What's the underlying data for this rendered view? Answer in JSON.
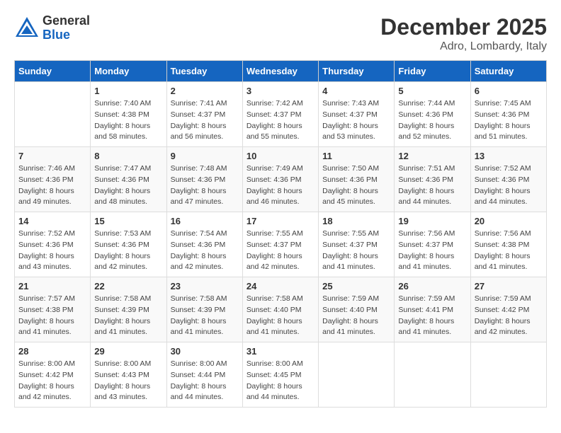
{
  "header": {
    "logo_general": "General",
    "logo_blue": "Blue",
    "month": "December 2025",
    "location": "Adro, Lombardy, Italy"
  },
  "weekdays": [
    "Sunday",
    "Monday",
    "Tuesday",
    "Wednesday",
    "Thursday",
    "Friday",
    "Saturday"
  ],
  "weeks": [
    [
      {
        "day": "",
        "sunrise": "",
        "sunset": "",
        "daylight": ""
      },
      {
        "day": "1",
        "sunrise": "Sunrise: 7:40 AM",
        "sunset": "Sunset: 4:38 PM",
        "daylight": "Daylight: 8 hours and 58 minutes."
      },
      {
        "day": "2",
        "sunrise": "Sunrise: 7:41 AM",
        "sunset": "Sunset: 4:37 PM",
        "daylight": "Daylight: 8 hours and 56 minutes."
      },
      {
        "day": "3",
        "sunrise": "Sunrise: 7:42 AM",
        "sunset": "Sunset: 4:37 PM",
        "daylight": "Daylight: 8 hours and 55 minutes."
      },
      {
        "day": "4",
        "sunrise": "Sunrise: 7:43 AM",
        "sunset": "Sunset: 4:37 PM",
        "daylight": "Daylight: 8 hours and 53 minutes."
      },
      {
        "day": "5",
        "sunrise": "Sunrise: 7:44 AM",
        "sunset": "Sunset: 4:36 PM",
        "daylight": "Daylight: 8 hours and 52 minutes."
      },
      {
        "day": "6",
        "sunrise": "Sunrise: 7:45 AM",
        "sunset": "Sunset: 4:36 PM",
        "daylight": "Daylight: 8 hours and 51 minutes."
      }
    ],
    [
      {
        "day": "7",
        "sunrise": "Sunrise: 7:46 AM",
        "sunset": "Sunset: 4:36 PM",
        "daylight": "Daylight: 8 hours and 49 minutes."
      },
      {
        "day": "8",
        "sunrise": "Sunrise: 7:47 AM",
        "sunset": "Sunset: 4:36 PM",
        "daylight": "Daylight: 8 hours and 48 minutes."
      },
      {
        "day": "9",
        "sunrise": "Sunrise: 7:48 AM",
        "sunset": "Sunset: 4:36 PM",
        "daylight": "Daylight: 8 hours and 47 minutes."
      },
      {
        "day": "10",
        "sunrise": "Sunrise: 7:49 AM",
        "sunset": "Sunset: 4:36 PM",
        "daylight": "Daylight: 8 hours and 46 minutes."
      },
      {
        "day": "11",
        "sunrise": "Sunrise: 7:50 AM",
        "sunset": "Sunset: 4:36 PM",
        "daylight": "Daylight: 8 hours and 45 minutes."
      },
      {
        "day": "12",
        "sunrise": "Sunrise: 7:51 AM",
        "sunset": "Sunset: 4:36 PM",
        "daylight": "Daylight: 8 hours and 44 minutes."
      },
      {
        "day": "13",
        "sunrise": "Sunrise: 7:52 AM",
        "sunset": "Sunset: 4:36 PM",
        "daylight": "Daylight: 8 hours and 44 minutes."
      }
    ],
    [
      {
        "day": "14",
        "sunrise": "Sunrise: 7:52 AM",
        "sunset": "Sunset: 4:36 PM",
        "daylight": "Daylight: 8 hours and 43 minutes."
      },
      {
        "day": "15",
        "sunrise": "Sunrise: 7:53 AM",
        "sunset": "Sunset: 4:36 PM",
        "daylight": "Daylight: 8 hours and 42 minutes."
      },
      {
        "day": "16",
        "sunrise": "Sunrise: 7:54 AM",
        "sunset": "Sunset: 4:36 PM",
        "daylight": "Daylight: 8 hours and 42 minutes."
      },
      {
        "day": "17",
        "sunrise": "Sunrise: 7:55 AM",
        "sunset": "Sunset: 4:37 PM",
        "daylight": "Daylight: 8 hours and 42 minutes."
      },
      {
        "day": "18",
        "sunrise": "Sunrise: 7:55 AM",
        "sunset": "Sunset: 4:37 PM",
        "daylight": "Daylight: 8 hours and 41 minutes."
      },
      {
        "day": "19",
        "sunrise": "Sunrise: 7:56 AM",
        "sunset": "Sunset: 4:37 PM",
        "daylight": "Daylight: 8 hours and 41 minutes."
      },
      {
        "day": "20",
        "sunrise": "Sunrise: 7:56 AM",
        "sunset": "Sunset: 4:38 PM",
        "daylight": "Daylight: 8 hours and 41 minutes."
      }
    ],
    [
      {
        "day": "21",
        "sunrise": "Sunrise: 7:57 AM",
        "sunset": "Sunset: 4:38 PM",
        "daylight": "Daylight: 8 hours and 41 minutes."
      },
      {
        "day": "22",
        "sunrise": "Sunrise: 7:58 AM",
        "sunset": "Sunset: 4:39 PM",
        "daylight": "Daylight: 8 hours and 41 minutes."
      },
      {
        "day": "23",
        "sunrise": "Sunrise: 7:58 AM",
        "sunset": "Sunset: 4:39 PM",
        "daylight": "Daylight: 8 hours and 41 minutes."
      },
      {
        "day": "24",
        "sunrise": "Sunrise: 7:58 AM",
        "sunset": "Sunset: 4:40 PM",
        "daylight": "Daylight: 8 hours and 41 minutes."
      },
      {
        "day": "25",
        "sunrise": "Sunrise: 7:59 AM",
        "sunset": "Sunset: 4:40 PM",
        "daylight": "Daylight: 8 hours and 41 minutes."
      },
      {
        "day": "26",
        "sunrise": "Sunrise: 7:59 AM",
        "sunset": "Sunset: 4:41 PM",
        "daylight": "Daylight: 8 hours and 41 minutes."
      },
      {
        "day": "27",
        "sunrise": "Sunrise: 7:59 AM",
        "sunset": "Sunset: 4:42 PM",
        "daylight": "Daylight: 8 hours and 42 minutes."
      }
    ],
    [
      {
        "day": "28",
        "sunrise": "Sunrise: 8:00 AM",
        "sunset": "Sunset: 4:42 PM",
        "daylight": "Daylight: 8 hours and 42 minutes."
      },
      {
        "day": "29",
        "sunrise": "Sunrise: 8:00 AM",
        "sunset": "Sunset: 4:43 PM",
        "daylight": "Daylight: 8 hours and 43 minutes."
      },
      {
        "day": "30",
        "sunrise": "Sunrise: 8:00 AM",
        "sunset": "Sunset: 4:44 PM",
        "daylight": "Daylight: 8 hours and 44 minutes."
      },
      {
        "day": "31",
        "sunrise": "Sunrise: 8:00 AM",
        "sunset": "Sunset: 4:45 PM",
        "daylight": "Daylight: 8 hours and 44 minutes."
      },
      {
        "day": "",
        "sunrise": "",
        "sunset": "",
        "daylight": ""
      },
      {
        "day": "",
        "sunrise": "",
        "sunset": "",
        "daylight": ""
      },
      {
        "day": "",
        "sunrise": "",
        "sunset": "",
        "daylight": ""
      }
    ]
  ]
}
